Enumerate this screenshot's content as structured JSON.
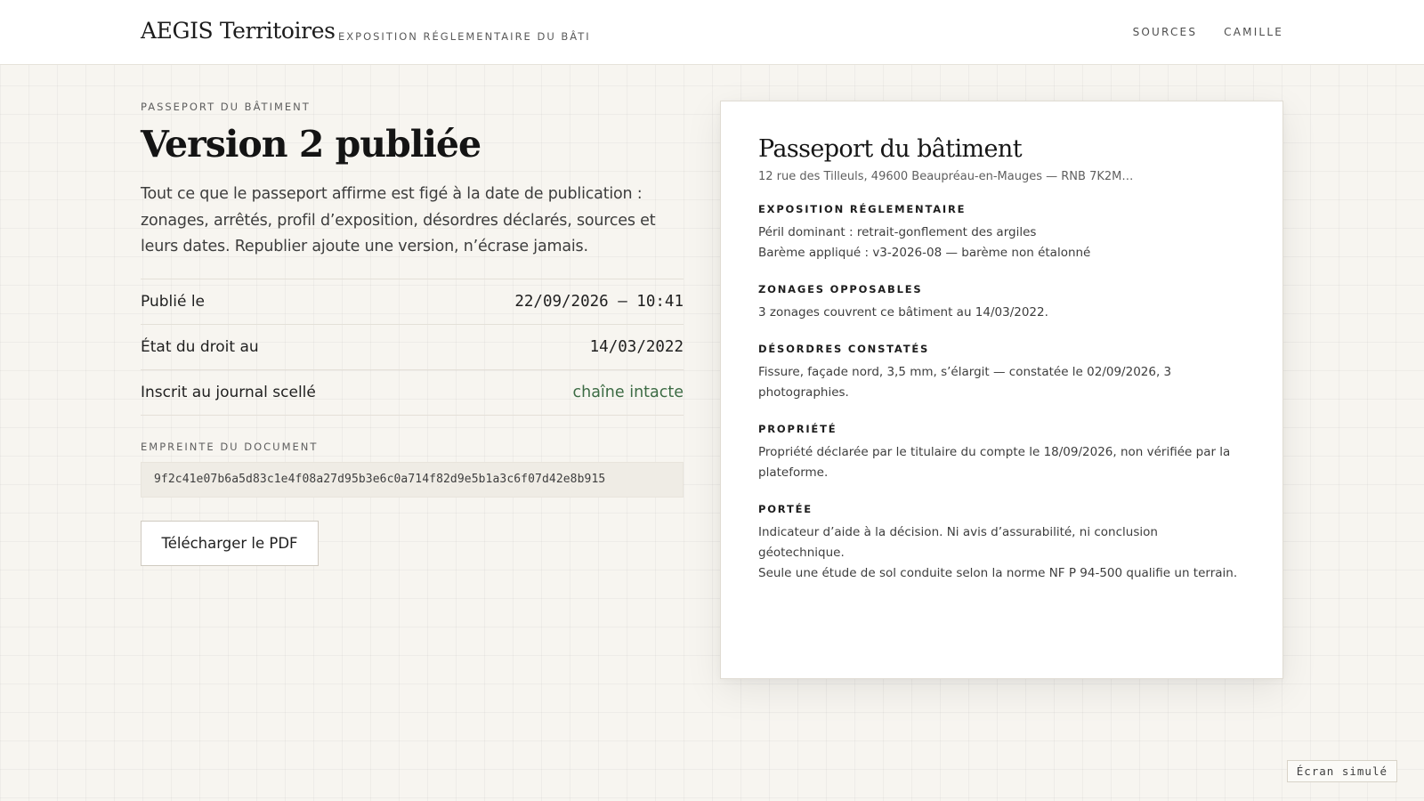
{
  "header": {
    "brand": "AEGIS Territoires",
    "tagline": "EXPOSITION RÉGLEMENTAIRE DU BÂTI",
    "nav": [
      "SOURCES",
      "CAMILLE"
    ]
  },
  "main": {
    "eyebrow": "PASSEPORT DU BÂTIMENT",
    "title": "Version 2 publiée",
    "intro": "Tout ce que le passeport affirme est figé à la date de publication : zonages, arrêtés, profil d’exposition, désordres déclarés, sources et leurs dates. Republier ajoute une version, n’écrase jamais.",
    "meta": [
      {
        "label": "Publié le",
        "value": "22/09/2026 — 10:41"
      },
      {
        "label": "État du droit au",
        "value": "14/03/2022"
      },
      {
        "label": "Inscrit au journal scellé",
        "value": "chaîne intacte"
      }
    ],
    "hash_label": "EMPREINTE DU DOCUMENT",
    "hash": "9f2c41e07b6a5d83c1e4f08a27d95b3e6c0a714f82d9e5b1a3c6f07d42e8b915",
    "download_label": "Télécharger le PDF"
  },
  "document": {
    "title": "Passeport du bâtiment",
    "address": "12 rue des Tilleuls, 49600 Beaupréau-en-Mauges — RNB 7K2M…",
    "sections": [
      {
        "heading": "EXPOSITION RÉGLEMENTAIRE",
        "lines": [
          "Péril dominant : retrait-gonflement des argiles",
          "Barème appliqué : v3-2026-08 — barème non étalonné"
        ]
      },
      {
        "heading": "ZONAGES OPPOSABLES",
        "lines": [
          "3 zonages couvrent ce bâtiment au 14/03/2022."
        ]
      },
      {
        "heading": "DÉSORDRES CONSTATÉS",
        "lines": [
          "Fissure, façade nord, 3,5 mm, s’élargit — constatée le 02/09/2026, 3 photographies."
        ]
      },
      {
        "heading": "PROPRIÉTÉ",
        "lines": [
          "Propriété déclarée par le titulaire du compte le 18/09/2026, non vérifiée par la plateforme."
        ]
      },
      {
        "heading": "PORTÉE",
        "lines": [
          "Indicateur d’aide à la décision. Ni avis d’assurabilité, ni conclusion géotechnique.",
          "Seule une étude de sol conduite selon la norme NF P 94-500 qualifie un terrain."
        ]
      }
    ]
  },
  "footer_stamp": "Écran simulé",
  "colors": {
    "ok": "#3c6b44",
    "background": "#f7f5f0"
  }
}
